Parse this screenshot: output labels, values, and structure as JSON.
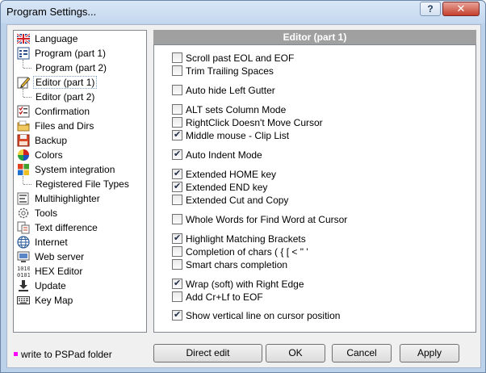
{
  "window": {
    "title": "Program Settings...",
    "help_label": "?",
    "close_label": "✕"
  },
  "sidebar": {
    "items": [
      {
        "label": "Language",
        "icon": "flag-uk-icon"
      },
      {
        "label": "Program  (part 1)",
        "icon": "program-settings-icon"
      },
      {
        "label": "Program  (part 2)",
        "icon": ""
      },
      {
        "label": "Editor  (part 1)",
        "icon": "edit-pencil-icon",
        "selected": true
      },
      {
        "label": "Editor  (part 2)",
        "icon": ""
      },
      {
        "label": "Confirmation",
        "icon": "checklist-icon"
      },
      {
        "label": "Files and Dirs",
        "icon": "folder-icon"
      },
      {
        "label": "Backup",
        "icon": "backup-disk-icon"
      },
      {
        "label": "Colors",
        "icon": "color-palette-icon"
      },
      {
        "label": "System integration",
        "icon": "windows-logo-icon"
      },
      {
        "label": "Registered File Types",
        "icon": ""
      },
      {
        "label": "Multihighlighter",
        "icon": "highlighter-icon"
      },
      {
        "label": "Tools",
        "icon": "gear-icon"
      },
      {
        "label": "Text difference",
        "icon": "text-diff-icon"
      },
      {
        "label": "Internet",
        "icon": "globe-icon"
      },
      {
        "label": "Web server",
        "icon": "web-server-icon"
      },
      {
        "label": "HEX Editor",
        "icon": "hex-binary-icon"
      },
      {
        "label": "Update",
        "icon": "update-download-icon"
      },
      {
        "label": "Key Map",
        "icon": "keyboard-icon"
      }
    ]
  },
  "panel": {
    "title": "Editor  (part 1)",
    "options": [
      {
        "label": "Scroll past EOL and EOF",
        "checked": false
      },
      {
        "label": "Trim Trailing Spaces",
        "checked": false
      },
      {
        "label": "Auto hide Left Gutter",
        "checked": false
      },
      {
        "label": "ALT sets Column Mode",
        "checked": false
      },
      {
        "label": "RightClick Doesn't Move Cursor",
        "checked": false
      },
      {
        "label": "Middle mouse - Clip List",
        "checked": true
      },
      {
        "label": "Auto Indent Mode",
        "checked": true
      },
      {
        "label": "Extended HOME key",
        "checked": true
      },
      {
        "label": "Extended END key",
        "checked": true
      },
      {
        "label": "Extended Cut and Copy",
        "checked": false
      },
      {
        "label": "Whole Words for Find Word at Cursor",
        "checked": false
      },
      {
        "label": "Highlight Matching Brackets",
        "checked": true
      },
      {
        "label": "Completion of chars ( { [ < \" '",
        "checked": false
      },
      {
        "label": "Smart chars completion",
        "checked": false
      },
      {
        "label": "Wrap (soft) with Right Edge",
        "checked": true
      },
      {
        "label": "Add Cr+Lf to EOF",
        "checked": false
      },
      {
        "label": "Show vertical line on cursor position",
        "checked": true
      }
    ]
  },
  "legend": {
    "text": "write to PSPad folder",
    "color": "#ff00ff"
  },
  "buttons": {
    "direct_edit": "Direct edit",
    "ok": "OK",
    "cancel": "Cancel",
    "apply": "Apply"
  },
  "colors": {
    "selection_border": "#7da2ce",
    "header_bg": "#a0a0a0"
  }
}
